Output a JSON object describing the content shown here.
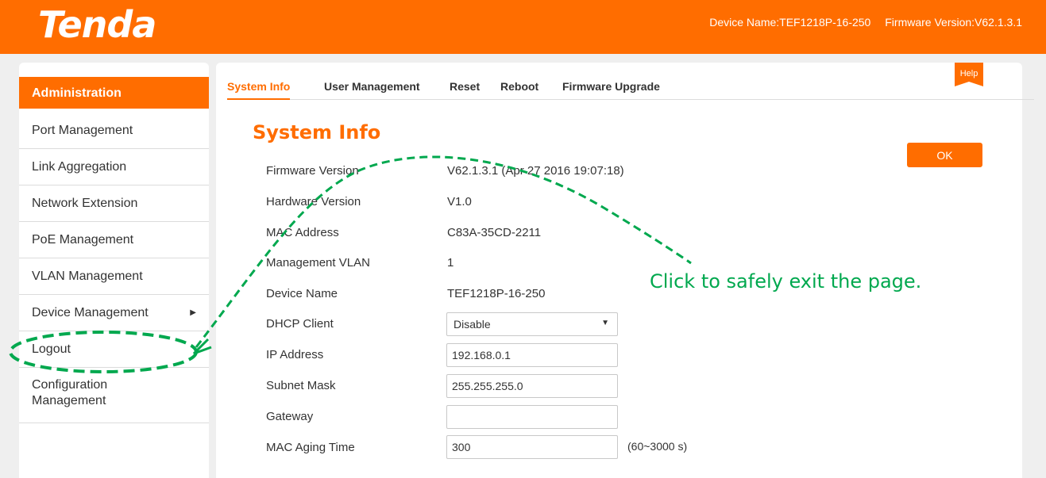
{
  "header": {
    "logo": "Tenda",
    "device_name": "Device Name:TEF1218P-16-250",
    "firmware_version": "Firmware Version:V62.1.3.1"
  },
  "sidebar": {
    "items": [
      {
        "label": "Administration"
      },
      {
        "label": "Port Management"
      },
      {
        "label": "Link Aggregation"
      },
      {
        "label": "Network Extension"
      },
      {
        "label": "PoE Management"
      },
      {
        "label": "VLAN Management"
      },
      {
        "label": "Device Management"
      },
      {
        "label": "Logout"
      },
      {
        "label": "Configuration"
      },
      {
        "label": "Management"
      }
    ]
  },
  "tabs": [
    {
      "label": "System Info"
    },
    {
      "label": "User Management"
    },
    {
      "label": "Reset"
    },
    {
      "label": "Reboot"
    },
    {
      "label": "Firmware Upgrade"
    }
  ],
  "help_label": "Help",
  "page_title": "System Info",
  "ok_label": "OK",
  "info": {
    "firmware_label": "Firmware Version",
    "firmware_value": "V62.1.3.1 (Apr 27 2016 19:07:18)",
    "hardware_label": "Hardware Version",
    "hardware_value": "V1.0",
    "mac_label": "MAC Address",
    "mac_value": "C83A-35CD-2211",
    "vlan_label": "Management VLAN",
    "vlan_value": "1",
    "device_label": "Device Name",
    "device_value": "TEF1218P-16-250",
    "dhcp_label": "DHCP Client",
    "dhcp_value": "Disable",
    "ip_label": "IP Address",
    "ip_value": "192.168.0.1",
    "subnet_label": "Subnet Mask",
    "subnet_value": "255.255.255.0",
    "gateway_label": "Gateway",
    "gateway_value": "",
    "aging_label": "MAC Aging Time",
    "aging_value": "300",
    "aging_unit": "(60~3000 s)"
  },
  "annotation": {
    "text": "Click to safely exit the page.",
    "color": "#00a84e"
  },
  "colors": {
    "accent": "#ff6d00"
  }
}
